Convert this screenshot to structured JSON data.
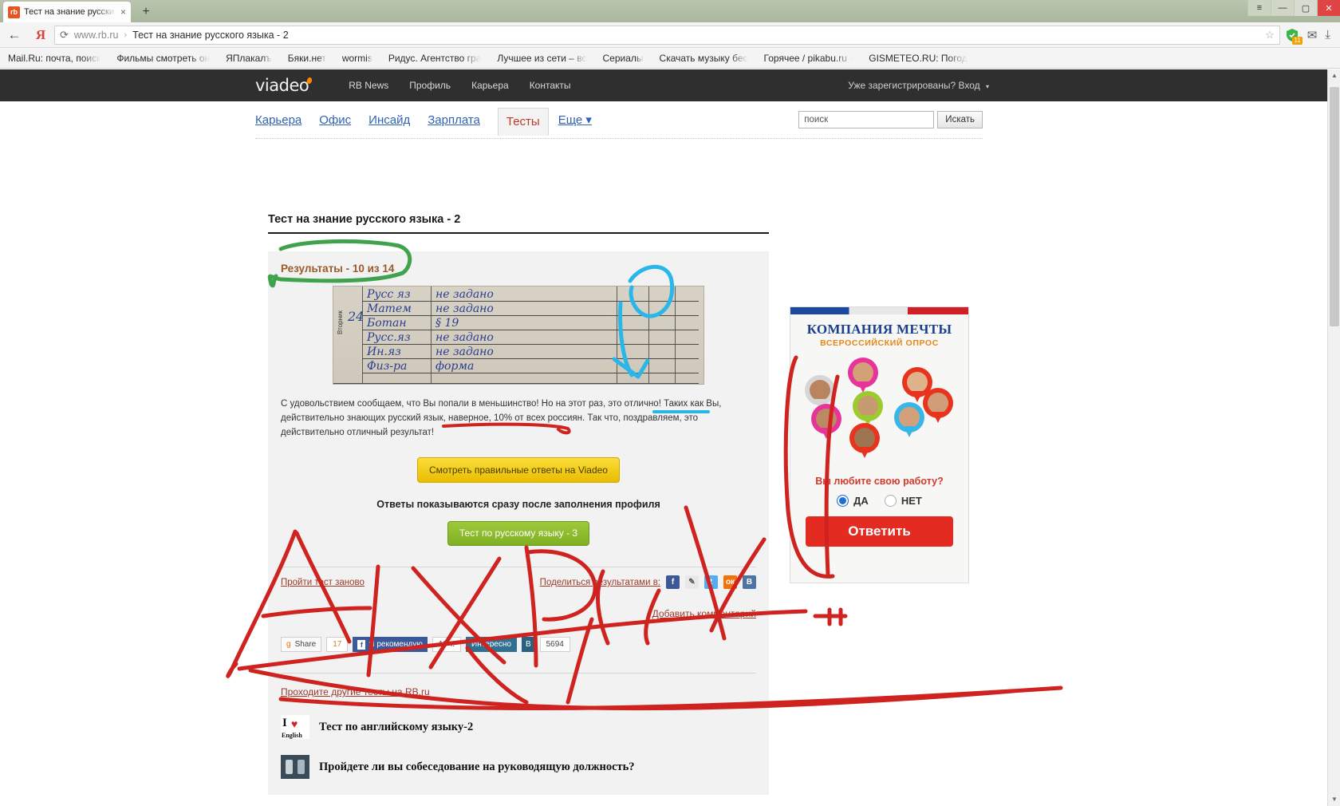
{
  "browser": {
    "tab": {
      "title": "Тест на знание русски",
      "favicon_label": "rb",
      "close_icon": "×"
    },
    "newtab_icon": "+",
    "window_buttons": {
      "menu": "≡",
      "minimize": "—",
      "maximize": "▢",
      "close": "✕"
    },
    "back_icon": "←",
    "yandex_icon": "Я",
    "reload_icon": "⟳",
    "url_host": "www.rb.ru",
    "url_separator": "›",
    "url_title": "Тест на знание русского языка - 2",
    "star_icon": "☆",
    "shield_badge": "11",
    "mail_icon": "✉",
    "download_icon": "⤓",
    "bookmarks": [
      "Mail.Ru: почта, поиск",
      "Фильмы смотреть он",
      "ЯПлакалъ",
      "Бяки.нет",
      "wormis",
      "Ридус. Агентство гра",
      "Лучшее из сети – вс",
      "Сериалы",
      "Скачать музыку бес",
      "Горячее / pikabu.ru -",
      "GISMETEO.RU: Погод"
    ]
  },
  "site": {
    "logo": "viadeo",
    "topnav": [
      "RB News",
      "Профиль",
      "Карьера",
      "Контакты"
    ],
    "account_text": "Уже зарегистрированы? Вход",
    "account_caret": "▾",
    "subnav": [
      {
        "label": "Карьера",
        "active": false
      },
      {
        "label": "Офис",
        "active": false
      },
      {
        "label": "Инсайд",
        "active": false
      },
      {
        "label": "Зарплата",
        "active": false
      },
      {
        "label": "Тесты",
        "active": true
      }
    ],
    "more_label": "Еще",
    "more_caret": "▾",
    "search": {
      "placeholder": "поиск",
      "value": "поиск",
      "button": "Искать"
    }
  },
  "main": {
    "page_title": "Тест на знание русского языка - 2",
    "result_score": "Результаты - 10 из 14",
    "scan": {
      "side_label": "Вторник",
      "day_number": "24",
      "rows": [
        {
          "subject": "Русс яз",
          "note": "не задано"
        },
        {
          "subject": "Матем",
          "note": "не задано"
        },
        {
          "subject": "Ботан",
          "note": "§ 19"
        },
        {
          "subject": "Русс.яз",
          "note": "не задано"
        },
        {
          "subject": "Ин.яз",
          "note": "не задано"
        },
        {
          "subject": "Физ-ра",
          "note": "форма"
        }
      ]
    },
    "result_text": "С удовольствием сообщаем, что Вы попали в меньшинство! Но на этот раз, это отлично! Таких как Вы, действительно знающих русский язык, наверное, 10% от всех россиян. Так что, поздравляем, это действительно отличный результат!",
    "btn_answers": "Смотреть правильные ответы на Viadeo",
    "note_profile": "Ответы показываются сразу после заполнения профиля",
    "btn_next_test": "Тест по русскому языку - 3",
    "retry_link": "Пройти тест заново",
    "share_label": "Поделиться результатами в:",
    "share_icons": [
      {
        "name": "facebook-icon",
        "glyph": "f"
      },
      {
        "name": "livejournal-icon",
        "glyph": "✎"
      },
      {
        "name": "twitter-icon",
        "glyph": "t"
      },
      {
        "name": "odnoklassniki-icon",
        "glyph": "ок"
      },
      {
        "name": "vkontakte-icon",
        "glyph": "В"
      }
    ],
    "comment_link": "Добавить комментарий",
    "social_bar": {
      "gplus_label": "Share",
      "gplus_icon": "g",
      "gplus_count": "17",
      "fb_label": "Я рекомендую",
      "fb_count": "19 т.",
      "vk_label": "Интересно",
      "vk_icon": "В",
      "vk_count": "5694"
    },
    "other_tests_link": "Проходите другие тесты на RB.ru",
    "other_tests": [
      {
        "title": "Тест по английскому языку-2",
        "thumb": "english-thumb",
        "thumb_i": "I",
        "thumb_heart": "♥",
        "thumb_label": "English"
      },
      {
        "title": "Пройдете ли вы собеседование на руководящую должность?",
        "thumb": "interview-thumb"
      }
    ]
  },
  "ad": {
    "title": "КОМПАНИЯ МЕЧТЫ",
    "subtitle": "ВСЕРОССИЙСКИЙ ОПРОС",
    "question": "Вы любите свою работу?",
    "options": [
      {
        "label": "ДА",
        "selected": true
      },
      {
        "label": "НЕТ",
        "selected": false
      }
    ],
    "button": "Ответить",
    "pin_colors": [
      "#d6d6d6",
      "#e8349a",
      "#e8341f",
      "#9ccb2e",
      "#e8349a",
      "#38b6e8",
      "#e8341f",
      "#e8341f"
    ]
  },
  "annotations": {
    "green_circle_color": "#3fa34d",
    "blue_marker_color": "#29b6e8",
    "red_marker_color": "#d4231f"
  },
  "colors": {
    "accent_orange": "#ff8a00",
    "link_blue": "#2f63b3",
    "link_red": "#9c3a2a",
    "header_dark": "#2f2f2f"
  }
}
